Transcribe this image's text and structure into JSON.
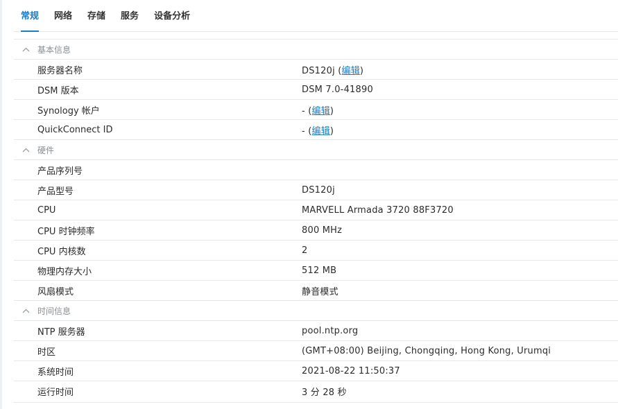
{
  "tabs": [
    {
      "label": "常规",
      "active": true
    },
    {
      "label": "网络",
      "active": false
    },
    {
      "label": "存储",
      "active": false
    },
    {
      "label": "服务",
      "active": false
    },
    {
      "label": "设备分析",
      "active": false
    }
  ],
  "sections": {
    "basic": {
      "title": "基本信息",
      "rows": [
        {
          "label": "服务器名称",
          "value": "DS120j",
          "link": "编辑"
        },
        {
          "label": "DSM 版本",
          "value": "DSM 7.0-41890"
        },
        {
          "label": "Synology 帐户",
          "value": "-",
          "link": "编辑"
        },
        {
          "label": "QuickConnect ID",
          "value": "-",
          "link": "编辑"
        }
      ]
    },
    "hardware": {
      "title": "硬件",
      "rows": [
        {
          "label": "产品序列号",
          "value": ""
        },
        {
          "label": "产品型号",
          "value": "DS120j"
        },
        {
          "label": "CPU",
          "value": "MARVELL Armada 3720 88F3720"
        },
        {
          "label": "CPU 时钟频率",
          "value": "800 MHz"
        },
        {
          "label": "CPU 内核数",
          "value": "2"
        },
        {
          "label": "物理内存大小",
          "value": "512 MB"
        },
        {
          "label": "风扇模式",
          "value": "静音模式"
        }
      ]
    },
    "time": {
      "title": "时间信息",
      "rows": [
        {
          "label": "NTP 服务器",
          "value": "pool.ntp.org"
        },
        {
          "label": "时区",
          "value": "(GMT+08:00) Beijing, Chongqing, Hong Kong, Urumqi"
        },
        {
          "label": "系统时间",
          "value": "2021-08-22 11:50:37"
        },
        {
          "label": "运行时间",
          "value": "3 分 28 秒"
        }
      ]
    }
  },
  "icons": {
    "collapse": "chevron-up-icon"
  },
  "colors": {
    "accent": "#1a7cc2",
    "border": "#e6e9ec",
    "section_text": "#8a8f94"
  }
}
